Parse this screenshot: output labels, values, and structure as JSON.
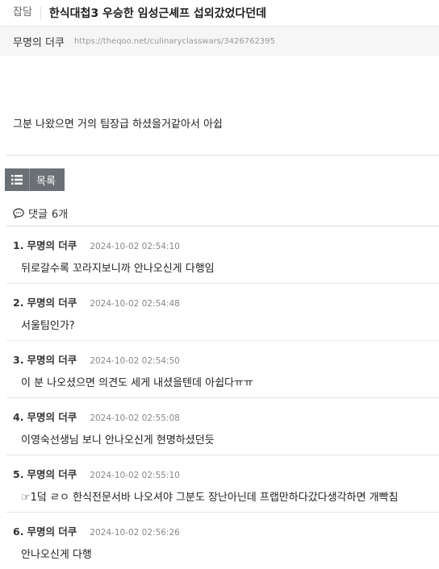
{
  "post": {
    "category": "잡담",
    "title": "한식대첩3 우승한 임성근셰프 섭외갔었다던데",
    "author": "무명의 더쿠",
    "url": "https://theqoo.net/culinaryclasswars/3426762395",
    "body": "그분 나왔으면 거의 팀장급 하셨을거같아서 아쉽"
  },
  "toolbar": {
    "list_label": "목록",
    "list_icon": "list-icon"
  },
  "comments_header": {
    "label": "댓글",
    "count": "6개",
    "icon": "speech-bubble-icon"
  },
  "comments": [
    {
      "index": "1.",
      "author": "무명의 더쿠",
      "time": "2024-10-02 02:54:10",
      "text": "뒤로갈수록 꼬라지보니까 안나오신게 다행임"
    },
    {
      "index": "2.",
      "author": "무명의 더쿠",
      "time": "2024-10-02 02:54:48",
      "text": "서울팀인가?"
    },
    {
      "index": "3.",
      "author": "무명의 더쿠",
      "time": "2024-10-02 02:54:50",
      "text": "이 분 나오셨으면 의견도 세게 내셨을텐데 아쉽다ㅠㅠ"
    },
    {
      "index": "4.",
      "author": "무명의 더쿠",
      "time": "2024-10-02 02:55:08",
      "text": "이영숙선생님 보니 안나오신게 현명하셨던듯"
    },
    {
      "index": "5.",
      "author": "무명의 더쿠",
      "time": "2024-10-02 02:55:10",
      "text": "☞1덬 ㄹㅇ 한식전문서바 나오셔야 그분도 장난아닌데 프랩만하다갔다생각하면 개빡침"
    },
    {
      "index": "6.",
      "author": "무명의 더쿠",
      "time": "2024-10-02 02:56:26",
      "text": "안나오신게 다행"
    }
  ]
}
